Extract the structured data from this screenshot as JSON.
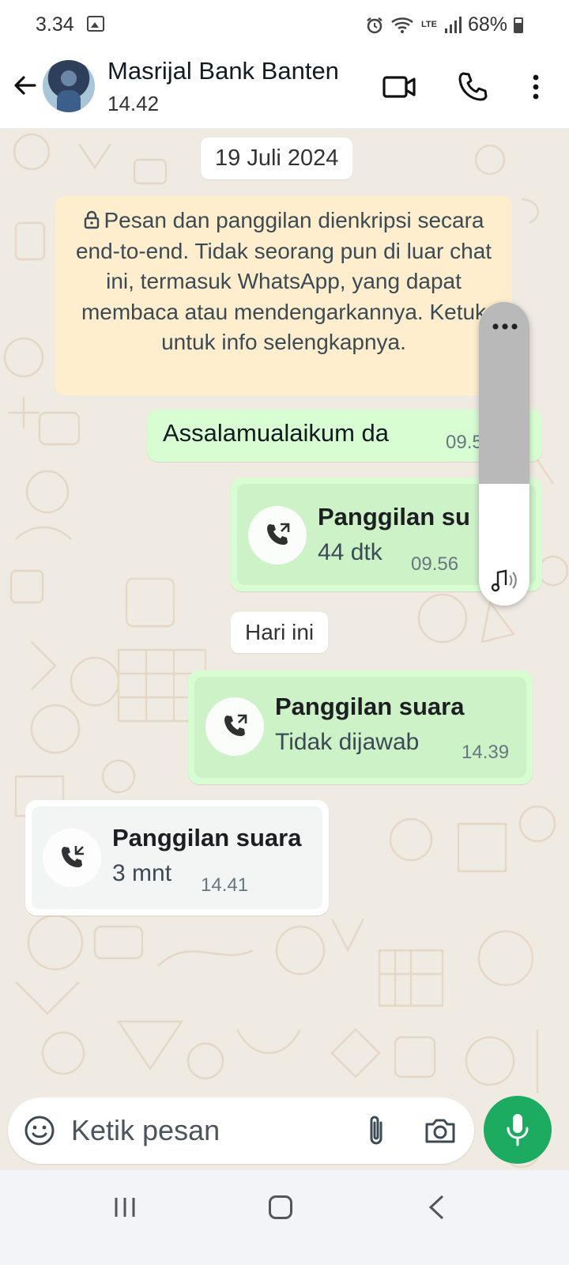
{
  "status_bar": {
    "time": "3.34",
    "battery": "68%",
    "network": "LTE"
  },
  "header": {
    "contact_name": "Masrijal Bank Banten",
    "last_seen": "14.42"
  },
  "chat": {
    "date_chip_1": "19 Juli 2024",
    "encryption_notice": "Pesan dan panggilan dienkripsi secara end-to-end. Tidak seorang pun di luar chat ini, termasuk WhatsApp, yang dapat membaca atau mendengarkannya. Ketuk untuk info selengkapnya.",
    "messages": [
      {
        "type": "text",
        "direction": "outgoing",
        "text": "Assalamualaikum da",
        "time": "09.5"
      },
      {
        "type": "call",
        "direction": "outgoing",
        "title": "Panggilan su",
        "subtitle": "44 dtk",
        "time": "09.56"
      },
      {
        "type": "call",
        "direction": "outgoing",
        "title": "Panggilan suara",
        "subtitle": "Tidak dijawab",
        "time": "14.39"
      },
      {
        "type": "call",
        "direction": "incoming",
        "title": "Panggilan suara",
        "subtitle": "3 mnt",
        "time": "14.41"
      }
    ],
    "date_chip_2": "Hari ini"
  },
  "volume_panel": {
    "level": 0.4
  },
  "input": {
    "placeholder": "Ketik pesan"
  },
  "colors": {
    "outgoing_bubble": "#d9fdd3",
    "chat_background": "#efeae2",
    "mic_button": "#1daa61",
    "notice_background": "#ffeecd"
  },
  "icons": [
    "back-arrow-icon",
    "video-call-icon",
    "voice-call-icon",
    "more-vert-icon",
    "lock-icon",
    "outgoing-call-icon",
    "incoming-call-icon",
    "more-dots-icon",
    "speaker-music-icon",
    "emoji-icon",
    "attach-icon",
    "camera-icon",
    "mic-icon"
  ]
}
